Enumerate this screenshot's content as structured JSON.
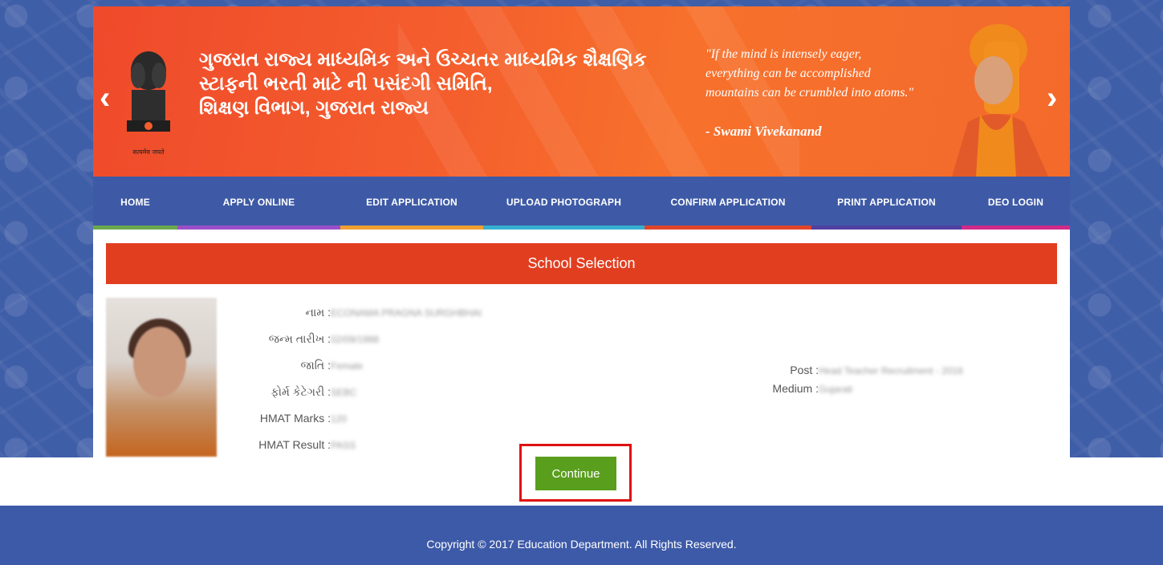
{
  "header": {
    "org_title_line1": "ગુજરાત રાજ્ય માધ્યમિક અને ઉચ્ચતર માધ્યમિક શૈક્ષણિક",
    "org_title_line2": "સ્ટાફની ભરતી માટે ની પસંદગી સમિતિ,",
    "org_title_line3": "શિક્ષણ વિભાગ, ગુજરાત રાજ્ય",
    "emblem_motto": "सत्यमेव जयते",
    "quote_line1": "\"If the mind is intensely eager,",
    "quote_line2": "everything can be accomplished",
    "quote_line3": "mountains can be crumbled into atoms.\"",
    "quote_author": "- Swami Vivekanand",
    "prev_arrow": "‹",
    "next_arrow": "›"
  },
  "nav": {
    "items": [
      {
        "label": "HOME",
        "color": "#6aa84f"
      },
      {
        "label": "APPLY ONLINE",
        "color": "#9b4fc9"
      },
      {
        "label": "EDIT APPLICATION",
        "color": "#f0a030"
      },
      {
        "label": "UPLOAD PHOTOGRAPH",
        "color": "#35b0d0"
      },
      {
        "label": "CONFIRM APPLICATION",
        "color": "#e0452a"
      },
      {
        "label": "PRINT APPLICATION",
        "color": "#5040a0"
      },
      {
        "label": "DEO LOGIN",
        "color": "#d02a8a"
      }
    ]
  },
  "section": {
    "title": "School Selection"
  },
  "applicant": {
    "fields": [
      {
        "label": "નામ :",
        "value": "ECONAMA PRAGNA SURGHBHAI"
      },
      {
        "label": "જન્મ તારીખ :",
        "value": "02/09/1988"
      },
      {
        "label": "જાતિ :",
        "value": "Female"
      },
      {
        "label": "ફોર્મ કેટેગરી :",
        "value": "SEBC"
      },
      {
        "label": "HMAT Marks :",
        "value": "120"
      },
      {
        "label": "HMAT Result :",
        "value": "PASS"
      }
    ],
    "post_label": "Post :",
    "post_value": "Head Teacher Recruitment - 2016",
    "medium_label": "Medium :",
    "medium_value": "Gujarati"
  },
  "actions": {
    "continue_label": "Continue"
  },
  "footer": {
    "copyright": "Copyright © 2017 Education Department. All Rights Reserved."
  },
  "colors": {
    "banner": "#f45d2d",
    "navbar": "#3e5aa6",
    "section_header": "#e13e20",
    "continue_button": "#5a9e1e",
    "highlight": "#e01010",
    "footer": "#3d5aa8"
  }
}
